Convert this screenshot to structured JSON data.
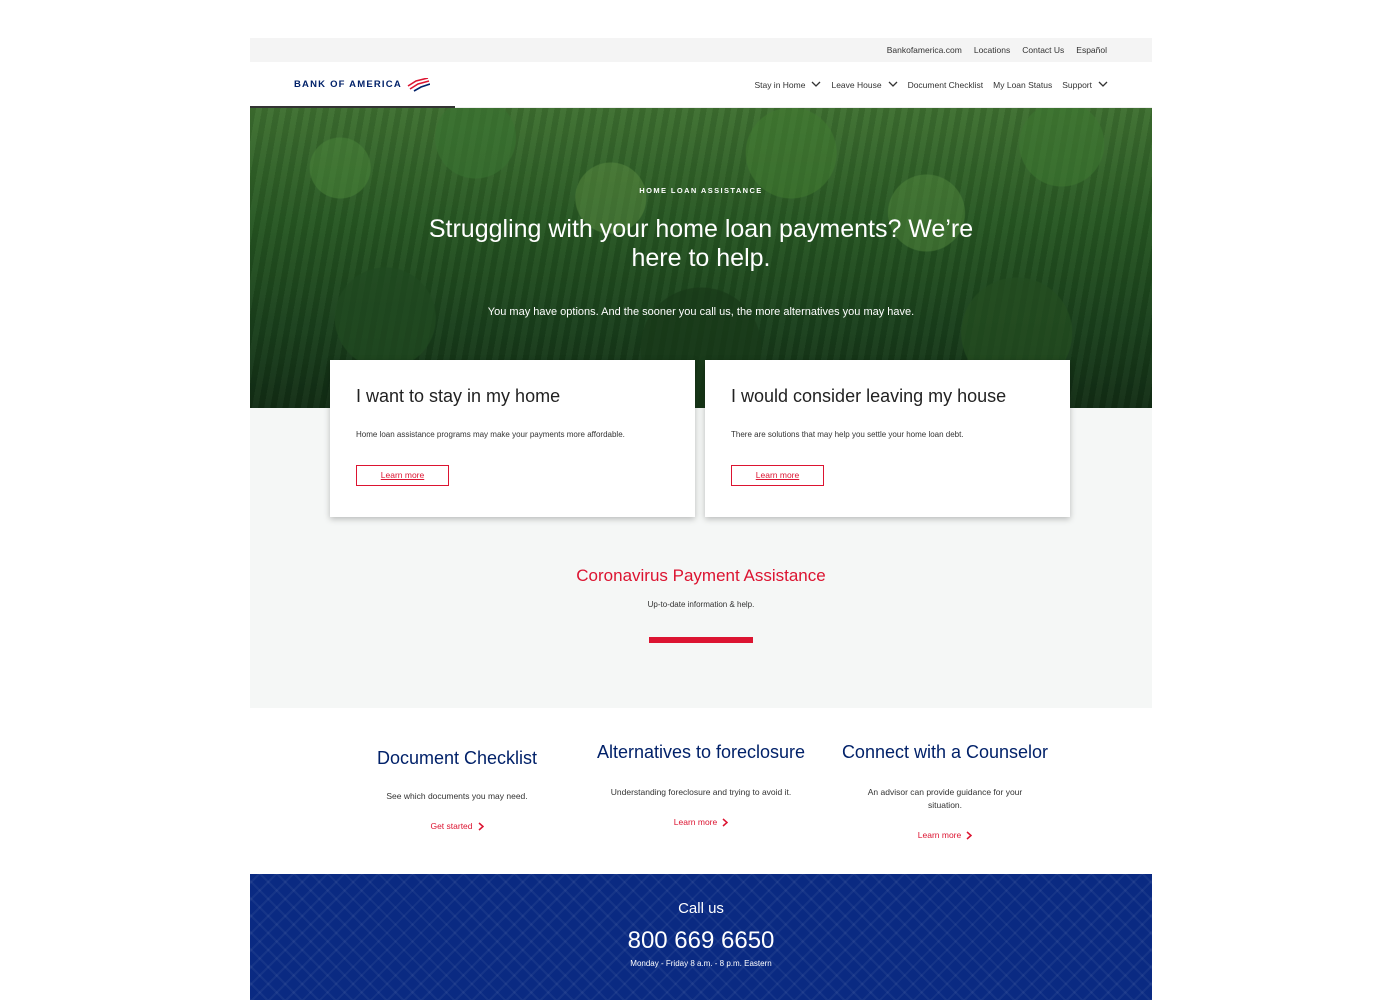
{
  "utility_links": [
    "Bankofamerica.com",
    "Locations",
    "Contact Us",
    "Español"
  ],
  "brand": {
    "name": "BANK OF AMERICA",
    "color": "#012169",
    "accent": "#dc1431"
  },
  "nav": {
    "items": [
      {
        "label": "Stay in Home",
        "dropdown": true
      },
      {
        "label": "Leave House",
        "dropdown": true
      },
      {
        "label": "Document Checklist",
        "dropdown": false
      },
      {
        "label": "My Loan Status",
        "dropdown": false
      },
      {
        "label": "Support",
        "dropdown": true
      }
    ]
  },
  "hero": {
    "eyebrow": "HOME LOAN ASSISTANCE",
    "title": "Struggling with your home loan payments? We’re here to help.",
    "subtitle": "You may have options. And the sooner you call us, the more alternatives you may have."
  },
  "cards": [
    {
      "title": "I want to stay in my home",
      "text": "Home loan assistance programs may make your payments more affordable.",
      "button": "Learn more"
    },
    {
      "title": "I would consider leaving my house",
      "text": "There are solutions that may help you settle your home loan debt.",
      "button": "Learn more"
    }
  ],
  "covid": {
    "title": "Coronavirus Payment Assistance",
    "subtitle": "Up-to-date information & help."
  },
  "features": [
    {
      "title": "Document Checklist",
      "text": "See which documents you may need.",
      "link": "Get started"
    },
    {
      "title": "Alternatives to foreclosure",
      "text": "Understanding foreclosure and trying to avoid it.",
      "link": "Learn more"
    },
    {
      "title": "Connect with a Counselor",
      "text": "An advisor can provide guidance for your situation.",
      "link": "Learn more"
    }
  ],
  "call": {
    "label": "Call us",
    "phone": "800 669 6650",
    "hours": "Monday - Friday 8 a.m. - 8 p.m. Eastern"
  }
}
